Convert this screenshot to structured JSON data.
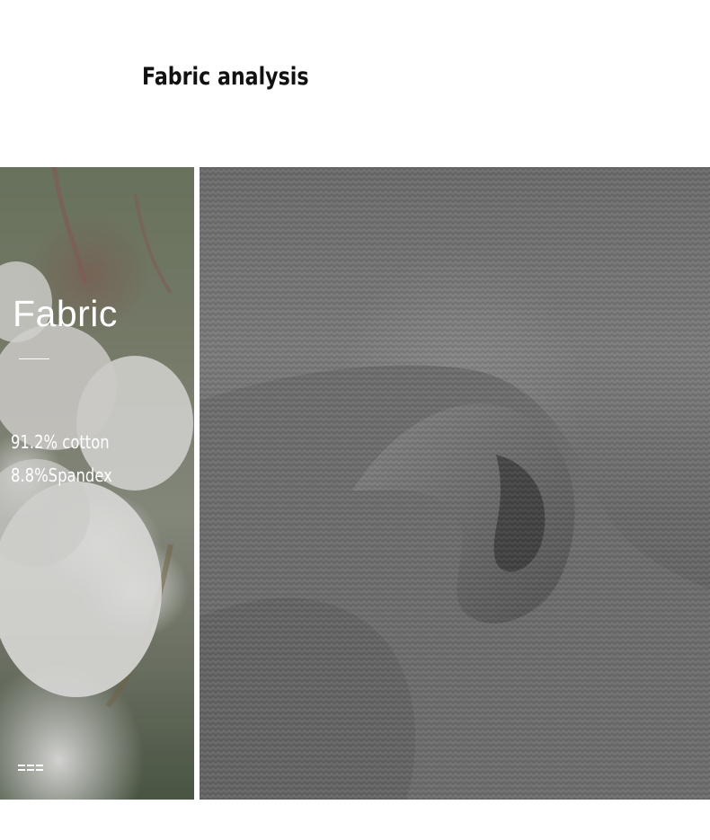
{
  "header": {
    "title": "Fabric analysis"
  },
  "left_panel": {
    "image": "cotton-boll-photo",
    "heading": "Fabric",
    "composition": [
      "91.2% cotton",
      "8.8%Spandex"
    ],
    "icon": "menu-lines-icon"
  },
  "right_panel": {
    "image": "gray-knit-fabric-photo"
  },
  "colors": {
    "background": "#ffffff",
    "title_text": "#111111",
    "overlay_text": "#ffffff",
    "fabric_gray": "#6f6f6f"
  }
}
